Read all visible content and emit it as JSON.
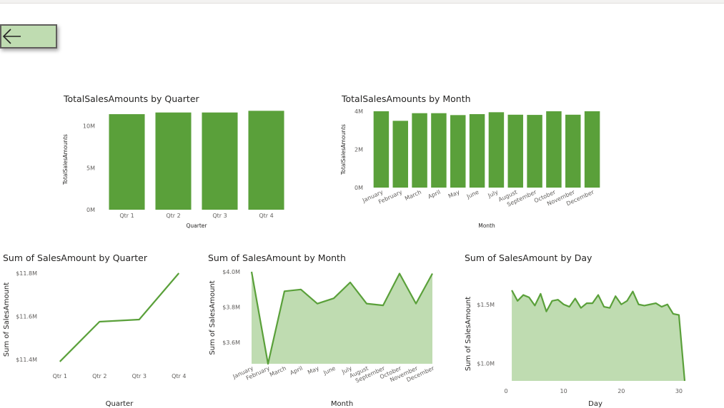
{
  "colors": {
    "accent": "#5aa03a",
    "area_fill": "#bfdcb1",
    "button_fill": "#bfdcb1"
  },
  "back_button": {
    "icon": "arrow-left-icon"
  },
  "chart_data": [
    {
      "id": "bar-quarter",
      "type": "bar",
      "title": "TotalSalesAmounts by Quarter",
      "xlabel": "Quarter",
      "ylabel": "TotalSalesAmounts",
      "categories": [
        "Qtr 1",
        "Qtr 2",
        "Qtr 3",
        "Qtr 4"
      ],
      "values": [
        11.4,
        11.6,
        11.6,
        11.8
      ],
      "ylim": [
        0,
        12
      ],
      "yticks": [
        0,
        5,
        10
      ],
      "ytick_labels": [
        "0M",
        "5M",
        "10M"
      ],
      "grid": false
    },
    {
      "id": "bar-month",
      "type": "bar",
      "title": "TotalSalesAmounts by Month",
      "xlabel": "Month",
      "ylabel": "TotalSalesAmounts",
      "categories": [
        "January",
        "February",
        "March",
        "April",
        "May",
        "June",
        "July",
        "August",
        "September",
        "October",
        "November",
        "December"
      ],
      "values": [
        4.0,
        3.5,
        3.9,
        3.9,
        3.8,
        3.85,
        3.95,
        3.82,
        3.81,
        4.0,
        3.82,
        4.0
      ],
      "ylim": [
        0,
        4.0
      ],
      "yticks": [
        0,
        2,
        4
      ],
      "ytick_labels": [
        "0M",
        "2M",
        "4M"
      ],
      "grid": false
    },
    {
      "id": "line-quarter",
      "type": "line",
      "title": "Sum of SalesAmount by Quarter",
      "xlabel": "Quarter",
      "ylabel": "Sum of SalesAmount",
      "categories": [
        "Qtr 1",
        "Qtr 2",
        "Qtr 3",
        "Qtr 4"
      ],
      "values": [
        11.39,
        11.575,
        11.585,
        11.8
      ],
      "ylim": [
        11.37,
        11.8
      ],
      "yticks": [
        11.4,
        11.6,
        11.8
      ],
      "ytick_labels": [
        "$11.4M",
        "$11.6M",
        "$11.8M"
      ],
      "grid": false
    },
    {
      "id": "area-month",
      "type": "area",
      "title": "Sum of SalesAmount by Month",
      "xlabel": "Month",
      "ylabel": "Sum of SalesAmount",
      "categories": [
        "January",
        "February",
        "March",
        "April",
        "May",
        "June",
        "July",
        "August",
        "September",
        "October",
        "November",
        "December"
      ],
      "values": [
        4.0,
        3.48,
        3.89,
        3.9,
        3.82,
        3.85,
        3.94,
        3.82,
        3.81,
        3.99,
        3.82,
        3.99
      ],
      "ylim": [
        3.48,
        4.0
      ],
      "yticks": [
        3.6,
        3.8,
        4.0
      ],
      "ytick_labels": [
        "$3.6M",
        "$3.8M",
        "$4.0M"
      ],
      "grid": false
    },
    {
      "id": "area-day",
      "type": "area",
      "title": "Sum of SalesAmount by Day",
      "xlabel": "Day",
      "ylabel": "Sum of SalesAmount",
      "x": [
        1,
        2,
        3,
        4,
        5,
        6,
        7,
        8,
        9,
        10,
        11,
        12,
        13,
        14,
        15,
        16,
        17,
        18,
        19,
        20,
        21,
        22,
        23,
        24,
        25,
        26,
        27,
        28,
        29,
        30,
        31
      ],
      "values": [
        1.62,
        1.53,
        1.58,
        1.56,
        1.49,
        1.59,
        1.44,
        1.53,
        1.54,
        1.5,
        1.48,
        1.55,
        1.47,
        1.51,
        1.51,
        1.58,
        1.48,
        1.47,
        1.57,
        1.5,
        1.53,
        1.61,
        1.5,
        1.49,
        1.5,
        1.51,
        1.48,
        1.5,
        1.42,
        1.41,
        0.85
      ],
      "ylim": [
        0.85,
        1.65
      ],
      "yticks": [
        1.0,
        1.5
      ],
      "ytick_labels": [
        "$1.0M",
        "$1.5M"
      ],
      "xlim": [
        0,
        31
      ],
      "xticks": [
        0,
        10,
        20,
        30
      ],
      "xtick_labels": [
        "0",
        "10",
        "20",
        "30"
      ],
      "grid": false
    }
  ]
}
